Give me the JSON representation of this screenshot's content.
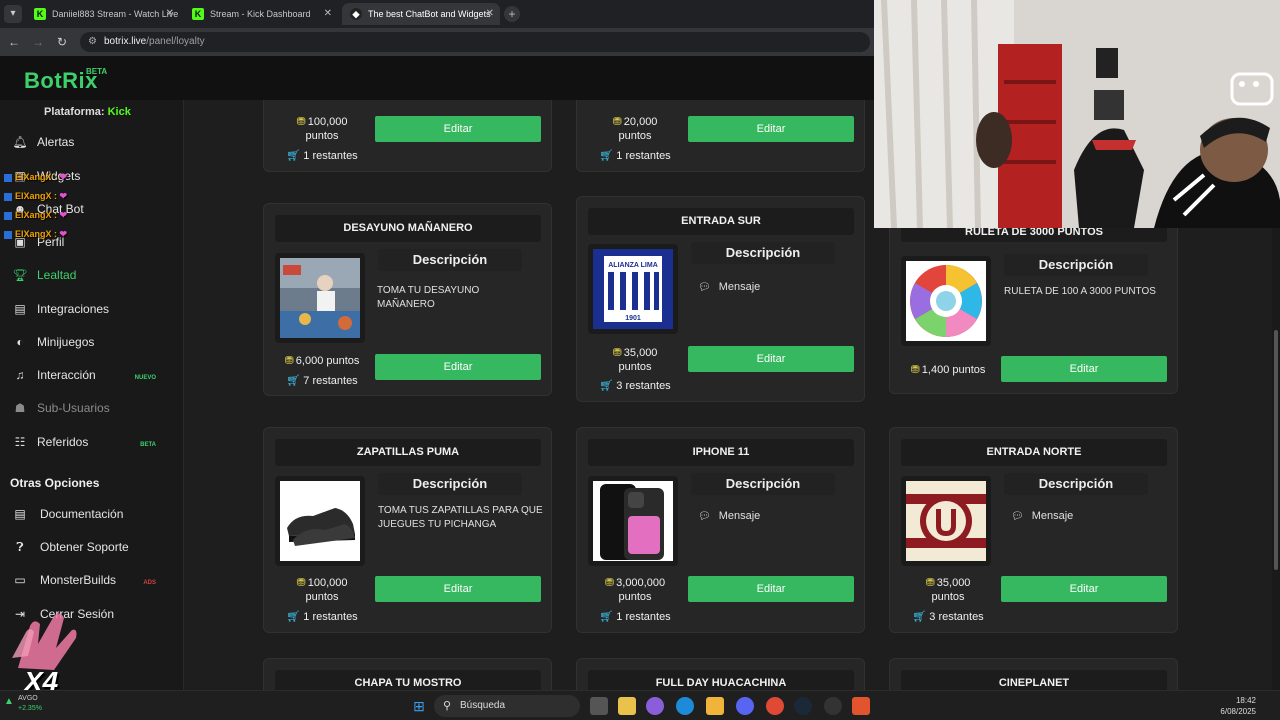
{
  "browser": {
    "tabs": [
      {
        "title": "Daniiel883 Stream - Watch Live",
        "favicon": "kick-icon"
      },
      {
        "title": "Stream - Kick Dashboard",
        "favicon": "kick-icon"
      },
      {
        "title": "The best ChatBot and Widgets",
        "favicon": "botrix-icon"
      }
    ],
    "url_host": "botrix.live",
    "url_path": "/panel/loyalty"
  },
  "app": {
    "logo": "BotRix",
    "logo_badge": "BETA",
    "platform_label": "Plataforma:",
    "platform_value": "Kick"
  },
  "sidebar": {
    "items": [
      {
        "label": "Alertas",
        "icon": "bell-icon"
      },
      {
        "label": "Widgets",
        "icon": "widget-icon"
      },
      {
        "label": "Chat Bot",
        "icon": "robot-icon"
      },
      {
        "label": "Perfil",
        "icon": "user-icon"
      },
      {
        "label": "Lealtad",
        "icon": "trophy-icon"
      },
      {
        "label": "Integraciones",
        "icon": "puzzle-icon"
      },
      {
        "label": "Minijuegos",
        "icon": "gamepad-icon"
      },
      {
        "label": "Interacción",
        "icon": "music-icon",
        "badge": "NUEVO"
      },
      {
        "label": "Sub-Usuarios",
        "icon": "users-icon"
      },
      {
        "label": "Referidos",
        "icon": "referral-icon",
        "badge": "BETA"
      }
    ],
    "other_title": "Otras Opciones",
    "other_items": [
      {
        "label": "Documentación",
        "icon": "book-icon"
      },
      {
        "label": "Obtener Soporte",
        "icon": "question-icon"
      },
      {
        "label": "MonsterBuilds",
        "icon": "monitor-icon",
        "badge": "ADS"
      },
      {
        "label": "Cerrar Sesión",
        "icon": "logout-icon"
      }
    ]
  },
  "chat_overlay": {
    "lines": [
      {
        "user": "ElXangX",
        "sep": ":"
      },
      {
        "user": "ElXangX",
        "sep": ":"
      },
      {
        "user": "ElXangX",
        "sep": ":"
      },
      {
        "user": "ElXangX",
        "sep": ":"
      }
    ],
    "multiplier": "X4"
  },
  "rewards": [
    {
      "title": "",
      "price": "100,000",
      "unit": "puntos",
      "stock": "1 restantes",
      "button": "Editar"
    },
    {
      "title": "",
      "price": "20,000",
      "unit": "puntos",
      "stock": "1 restantes",
      "button": "Editar"
    },
    {
      "title": "DESAYUNO MAÑANERO",
      "desc_title": "Descripción",
      "desc": "TOMA TU DESAYUNO MAÑANERO",
      "price": "6,000 puntos",
      "stock": "7 restantes",
      "button": "Editar"
    },
    {
      "title": "ENTRADA SUR",
      "desc_title": "Descripción",
      "desc": "Mensaje",
      "price": "35,000",
      "unit": "puntos",
      "stock": "3 restantes",
      "button": "Editar"
    },
    {
      "title": "RULETA DE 3000 PUNTOS",
      "desc_title": "Descripción",
      "desc": "RULETA DE 100 A 3000 PUNTOS",
      "price": "1,400 puntos",
      "button": "Editar"
    },
    {
      "title": "ZAPATILLAS PUMA",
      "desc_title": "Descripción",
      "desc": "TOMA TUS ZAPATILLAS PARA QUE JUEGUES TU PICHANGA",
      "price": "100,000",
      "unit": "puntos",
      "stock": "1 restantes",
      "button": "Editar"
    },
    {
      "title": "IPHONE 11",
      "desc_title": "Descripción",
      "desc": "Mensaje",
      "price": "3,000,000",
      "unit": "puntos",
      "stock": "1 restantes",
      "button": "Editar"
    },
    {
      "title": "ENTRADA NORTE",
      "desc_title": "Descripción",
      "desc": "Mensaje",
      "price": "35,000",
      "unit": "puntos",
      "stock": "3 restantes",
      "button": "Editar"
    },
    {
      "title": "CHAPA TU MOSTRO"
    },
    {
      "title": "FULL DAY HUACACHINA"
    },
    {
      "title": "CINEPLANET"
    }
  ],
  "images": {
    "alianza_text": "ALIANZA LIMA",
    "alianza_year": "1901",
    "alianza_club": "CLUB"
  },
  "taskbar": {
    "search_placeholder": "Búsqueda",
    "ticker_name": "AVGO",
    "ticker_change": "+2.35%",
    "time": "18:42",
    "date": "6/08/2025"
  },
  "colors": {
    "accent": "#3dd16b",
    "button": "#35b85f",
    "kick": "#53fc18"
  }
}
